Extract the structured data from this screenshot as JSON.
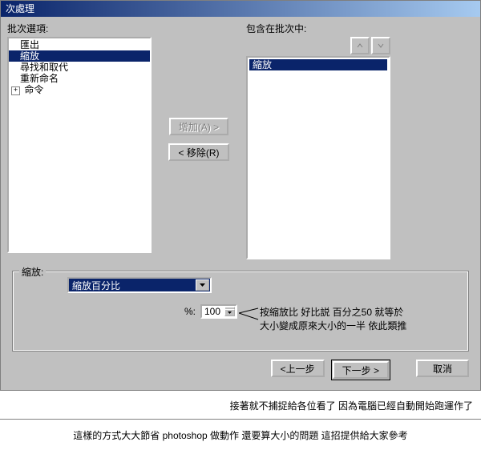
{
  "window": {
    "title": "次處理"
  },
  "labels": {
    "batch_options": "批次選項:",
    "included": "包含在批次中:",
    "zoom_group": "縮放:",
    "pct": "%:"
  },
  "options_list": {
    "items": [
      "匯出",
      "縮放",
      "尋找和取代",
      "重新命名",
      "命令"
    ],
    "selected_index": 1,
    "has_children_index": 4
  },
  "included_list": {
    "selected": "縮放"
  },
  "buttons": {
    "add": "增加(A) >",
    "remove": "< 移除(R)",
    "back": "<上一步",
    "next": "下一步 >",
    "cancel": "取消"
  },
  "zoom": {
    "combo": "縮放百分比",
    "value": "100"
  },
  "annotations": {
    "line1": "按縮放比 好比説 百分之50 就等於",
    "line2": "大小變成原來大小的一半 依此類推",
    "caption1": "接著就不捕捉給各位看了 因為電腦已經自動開始跑運作了",
    "caption2": "這樣的方式大大節省 photoshop 做動作 還要算大小的問題 這招提供給大家參考"
  }
}
